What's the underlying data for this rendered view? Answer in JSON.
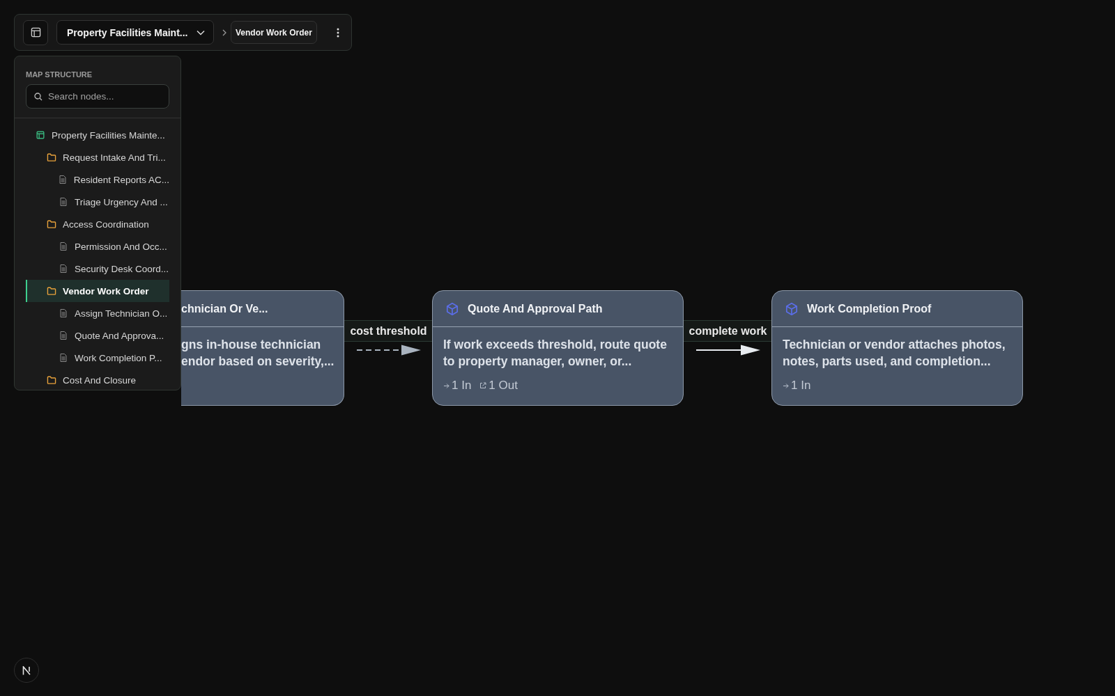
{
  "toolbar": {
    "map_title": "Property Facilities Maint...",
    "breadcrumb": "Vendor Work Order"
  },
  "sidebar": {
    "heading": "MAP STRUCTURE",
    "search": {
      "placeholder": "Search nodes..."
    },
    "tree": [
      {
        "kind": "map",
        "label": "Property Facilities Mainte...",
        "selected": false,
        "children": [
          {
            "kind": "folder",
            "label": "Request Intake And Tri...",
            "selected": false,
            "children": [
              {
                "kind": "doc",
                "label": "Resident Reports AC...",
                "selected": false
              },
              {
                "kind": "doc",
                "label": "Triage Urgency And ...",
                "selected": false
              }
            ]
          },
          {
            "kind": "folder",
            "label": "Access Coordination",
            "selected": false,
            "children": [
              {
                "kind": "doc",
                "label": "Permission And Occ...",
                "selected": false
              },
              {
                "kind": "doc",
                "label": "Security Desk Coord...",
                "selected": false
              }
            ]
          },
          {
            "kind": "folder",
            "label": "Vendor Work Order",
            "selected": true,
            "children": [
              {
                "kind": "doc",
                "label": "Assign Technician O...",
                "selected": false
              },
              {
                "kind": "doc",
                "label": "Quote And Approva...",
                "selected": false
              },
              {
                "kind": "doc",
                "label": "Work Completion P...",
                "selected": false
              }
            ]
          },
          {
            "kind": "folder",
            "label": "Cost And Closure",
            "selected": false
          }
        ]
      }
    ]
  },
  "canvas": {
    "nodes": [
      {
        "covered": true,
        "title": "chnician Or Ve...",
        "lines": [
          "gns in-house technician",
          "endor based on severity,..."
        ]
      },
      {
        "covered": false,
        "title": "Quote And Approval Path",
        "lines": [
          "If work exceeds threshold, route quote",
          "to property manager, owner, or..."
        ],
        "ports": [
          {
            "kind": "in",
            "label": "1 In"
          },
          {
            "kind": "out",
            "label": "1 Out"
          }
        ]
      },
      {
        "covered": false,
        "title": "Work Completion Proof",
        "lines": [
          "Technician or vendor attaches photos,",
          "notes, parts used, and completion..."
        ],
        "ports": [
          {
            "kind": "in",
            "label": "1 In"
          }
        ]
      }
    ],
    "edges": [
      {
        "label": "cost threshold",
        "dashed": true
      },
      {
        "label": "complete work",
        "dashed": false
      }
    ]
  }
}
